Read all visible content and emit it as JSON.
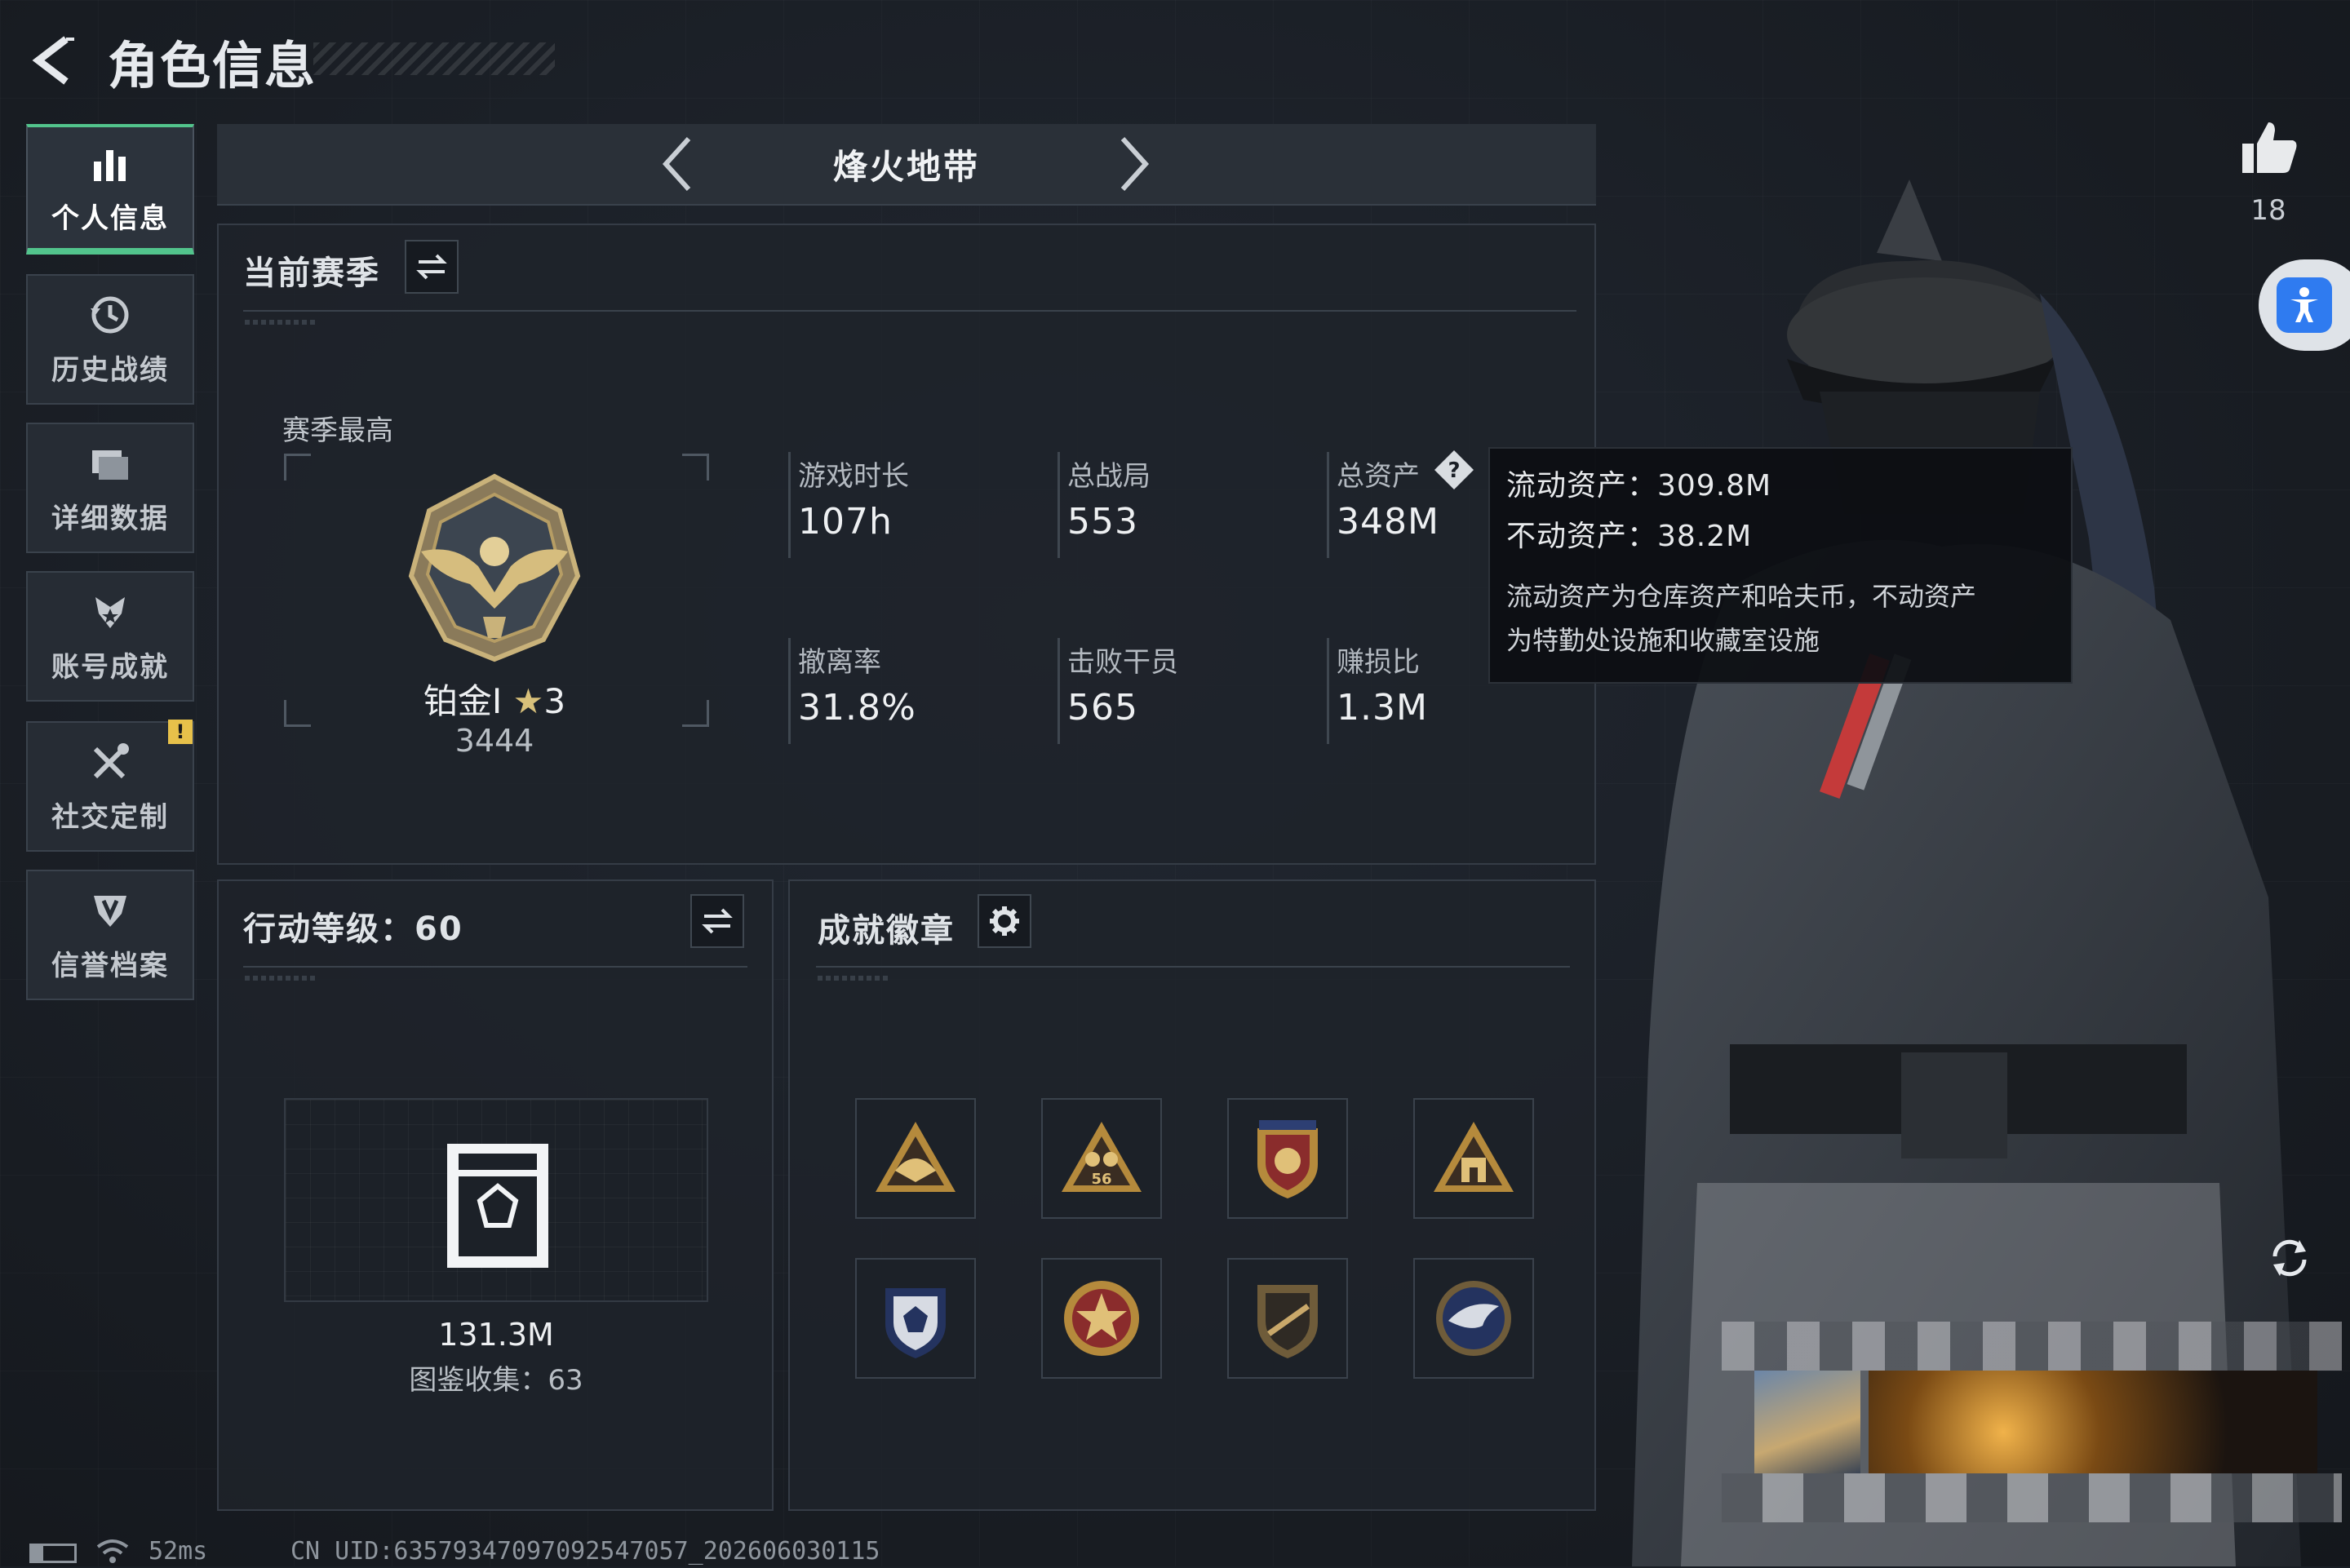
{
  "header": {
    "title": "角色信息",
    "back_icon": "back-arrow-icon"
  },
  "sidebar": {
    "items": [
      {
        "label": "个人信息",
        "icon": "bar-chart-icon",
        "active": true
      },
      {
        "label": "历史战绩",
        "icon": "history-clock-icon",
        "active": false
      },
      {
        "label": "详细数据",
        "icon": "folder-icon",
        "active": false
      },
      {
        "label": "账号成就",
        "icon": "achievement-icon",
        "active": false
      },
      {
        "label": "社交定制",
        "icon": "tools-icon",
        "active": false,
        "badge": "!"
      },
      {
        "label": "信誉档案",
        "icon": "credit-shield-icon",
        "active": false
      }
    ]
  },
  "mode": {
    "name": "烽火地带"
  },
  "season": {
    "title": "当前赛季",
    "best_label": "赛季最高",
    "rank_name": "铂金Ⅰ",
    "rank_stars": "3",
    "rank_points": "3444",
    "stats": [
      {
        "label": "游戏时长",
        "value": "107h"
      },
      {
        "label": "总战局",
        "value": "553"
      },
      {
        "label": "总资产",
        "value": "348M"
      },
      {
        "label": "撤离率",
        "value": "31.8%"
      },
      {
        "label": "击败干员",
        "value": "565"
      },
      {
        "label": "赚损比",
        "value": "1.3M"
      }
    ]
  },
  "tooltip": {
    "liquid": "流动资产：309.8M",
    "fixed": "不动资产：38.2M",
    "desc_1": "流动资产为仓库资产和哈夫币，不动资产",
    "desc_2": "为特勤处设施和收藏室设施"
  },
  "action_level": {
    "title": "行动等级：60",
    "value": "131.3M",
    "collection": "图鉴收集：63"
  },
  "achievements": {
    "title": "成就徽章",
    "badges": [
      "tent-badge-icon",
      "glasses-56-badge-icon",
      "eagle-shield-badge-icon",
      "house-badge-icon",
      "star-shield-badge-icon",
      "star-medal-badge-icon",
      "rifle-shield-badge-icon",
      "eagle-round-badge-icon"
    ]
  },
  "likes": {
    "count": "18"
  },
  "status": {
    "ping": "52ms",
    "uid": "CN UID:6357934709709​2547057_202606030115"
  },
  "colors": {
    "accent": "#52c48c",
    "warning": "#e7c14a",
    "accessibility": "#2f7bf0"
  }
}
